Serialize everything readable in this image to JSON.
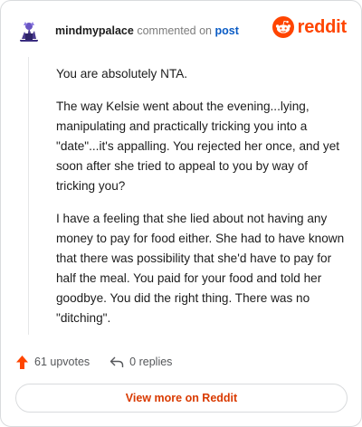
{
  "colors": {
    "accent": "#ff4500",
    "link": "#0b5cc5",
    "view_more_text": "#d93a00",
    "border": "#d9dbdd"
  },
  "header": {
    "username": "mindmypalace",
    "action_text": "commented on",
    "post_link": "post",
    "brand": "reddit",
    "avatar_icon": "avatar-icon",
    "brand_icon": "reddit-logo-icon"
  },
  "comment": {
    "paragraphs": [
      "You are absolutely NTA.",
      "The way Kelsie went about the evening...lying, manipulating and practically tricking you into a \"date\"...it's appalling. You rejected her once, and yet soon after she tried to appeal to you by way of tricking you?",
      "I have a feeling that she lied about not having any money to pay for food either. She had to have known that there was possibility that she'd have to pay for half the meal. You paid for your food and told her goodbye. You did the right thing. There was no \"ditching\"."
    ]
  },
  "actions": {
    "upvotes": "61 upvotes",
    "replies": "0 replies",
    "upvote_icon": "upvote-arrow-icon",
    "reply_icon": "reply-icon"
  },
  "footer": {
    "view_more": "View more on Reddit"
  }
}
